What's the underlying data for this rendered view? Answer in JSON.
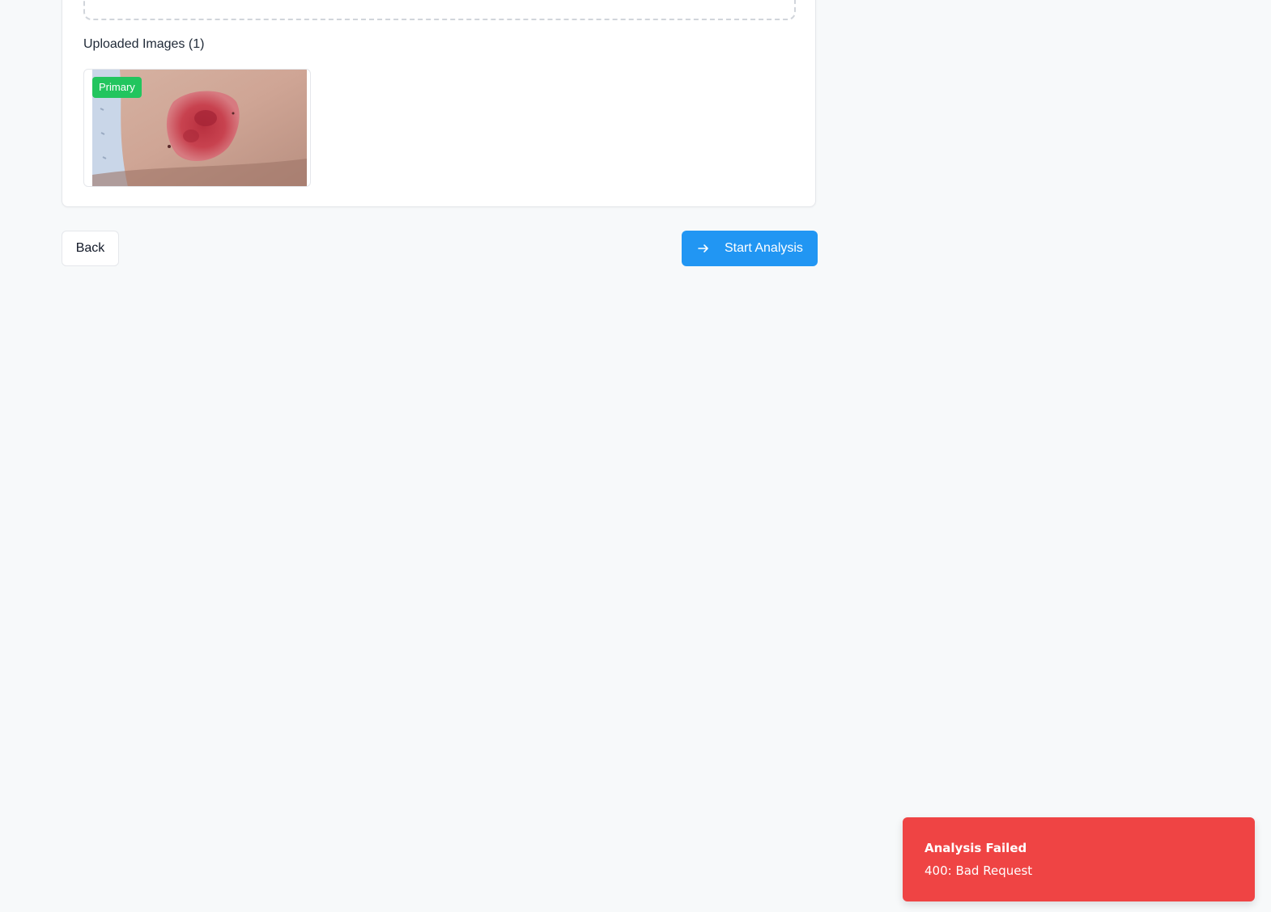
{
  "uploads": {
    "label": "Uploaded Images (1)",
    "images": [
      {
        "badge": "Primary",
        "badge_color": "#22c55e"
      }
    ]
  },
  "actions": {
    "back_label": "Back",
    "start_label": "Start Analysis",
    "start_icon": "arrow-right-icon",
    "accent_color": "#2196f3"
  },
  "toast": {
    "title": "Analysis Failed",
    "description": "400: Bad Request",
    "color": "#ef4444"
  }
}
